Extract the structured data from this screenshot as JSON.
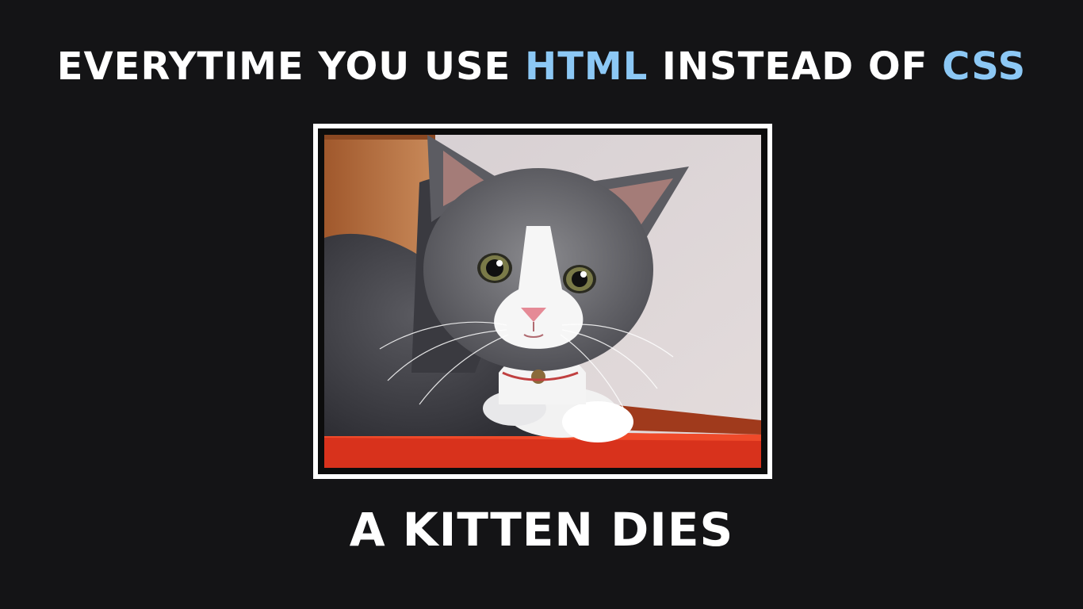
{
  "headline": {
    "part1": "EVERYTIME YOU USE ",
    "highlight1": "HTML",
    "part2": " INSTEAD OF ",
    "highlight2": "CSS"
  },
  "caption": "A KITTEN DIES",
  "colors": {
    "background": "#141416",
    "text": "#ffffff",
    "highlight": "#8cc8f5",
    "frame": "#ffffff"
  },
  "image": {
    "subject": "grey-and-white-kitten"
  }
}
